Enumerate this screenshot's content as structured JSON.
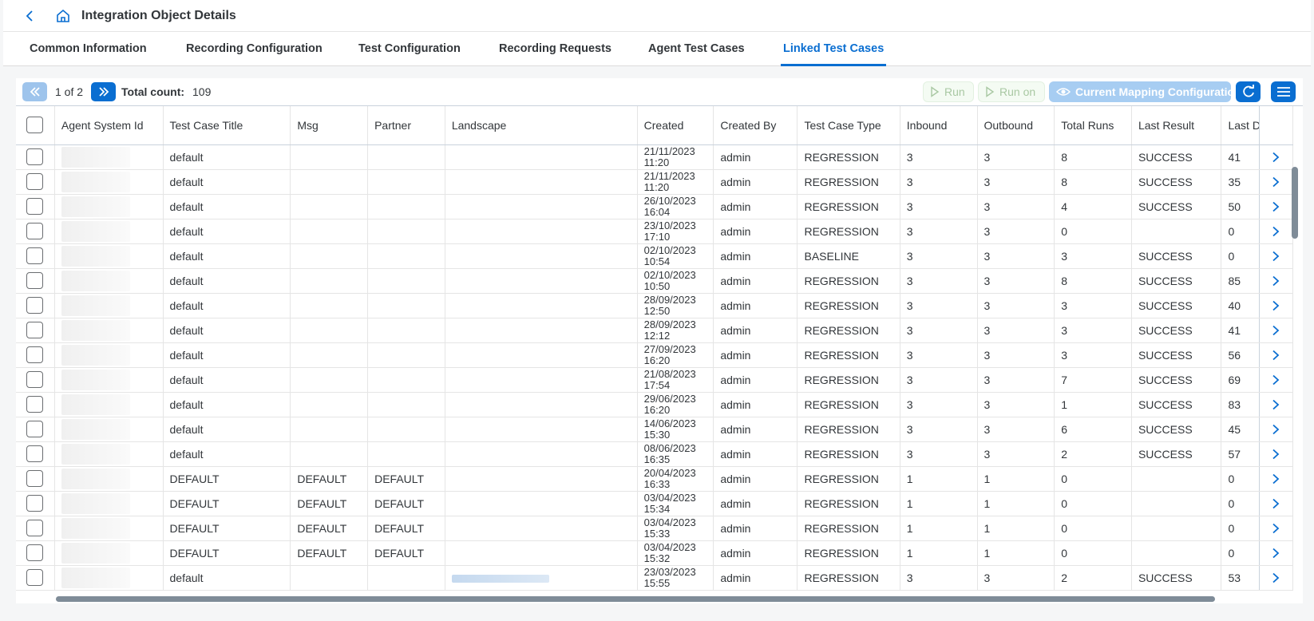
{
  "header": {
    "title": "Integration Object Details",
    "back_icon": "chevron-left-icon",
    "home_icon": "home-icon"
  },
  "tabs": [
    {
      "label": "Common Information",
      "active": false
    },
    {
      "label": "Recording Configuration",
      "active": false
    },
    {
      "label": "Test Configuration",
      "active": false
    },
    {
      "label": "Recording Requests",
      "active": false
    },
    {
      "label": "Agent Test Cases",
      "active": false
    },
    {
      "label": "Linked Test Cases",
      "active": true
    }
  ],
  "toolbar": {
    "page_indicator": "1 of 2",
    "total_count_label": "Total count:",
    "total_count_value": "109",
    "run_label": "Run",
    "run_on_label": "Run on",
    "mapping_label": "Current Mapping Configuration"
  },
  "table": {
    "columns": [
      "Agent System Id",
      "Test Case Title",
      "Msg",
      "Partner",
      "Landscape",
      "Created",
      "Created By",
      "Test Case Type",
      "Inbound",
      "Outbound",
      "Total Runs",
      "Last Result",
      "Last D"
    ],
    "rows": [
      {
        "title": "default",
        "msg": "",
        "partner": "",
        "landscape": "",
        "created": "21/11/2023 11:20",
        "created_by": "admin",
        "type": "REGRESSION",
        "inbound": "3",
        "outbound": "3",
        "total_runs": "8",
        "last_result": "SUCCESS",
        "last_d": "41"
      },
      {
        "title": "default",
        "msg": "",
        "partner": "",
        "landscape": "",
        "created": "21/11/2023 11:20",
        "created_by": "admin",
        "type": "REGRESSION",
        "inbound": "3",
        "outbound": "3",
        "total_runs": "8",
        "last_result": "SUCCESS",
        "last_d": "35"
      },
      {
        "title": "default",
        "msg": "",
        "partner": "",
        "landscape": "",
        "created": "26/10/2023 16:04",
        "created_by": "admin",
        "type": "REGRESSION",
        "inbound": "3",
        "outbound": "3",
        "total_runs": "4",
        "last_result": "SUCCESS",
        "last_d": "50"
      },
      {
        "title": "default",
        "msg": "",
        "partner": "",
        "landscape": "",
        "created": "23/10/2023 17:10",
        "created_by": "admin",
        "type": "REGRESSION",
        "inbound": "3",
        "outbound": "3",
        "total_runs": "0",
        "last_result": "",
        "last_d": "0"
      },
      {
        "title": "default",
        "msg": "",
        "partner": "",
        "landscape": "",
        "created": "02/10/2023 10:54",
        "created_by": "admin",
        "type": "BASELINE",
        "inbound": "3",
        "outbound": "3",
        "total_runs": "3",
        "last_result": "SUCCESS",
        "last_d": "0"
      },
      {
        "title": "default",
        "msg": "",
        "partner": "",
        "landscape": "",
        "created": "02/10/2023 10:50",
        "created_by": "admin",
        "type": "REGRESSION",
        "inbound": "3",
        "outbound": "3",
        "total_runs": "8",
        "last_result": "SUCCESS",
        "last_d": "85"
      },
      {
        "title": "default",
        "msg": "",
        "partner": "",
        "landscape": "",
        "created": "28/09/2023 12:50",
        "created_by": "admin",
        "type": "REGRESSION",
        "inbound": "3",
        "outbound": "3",
        "total_runs": "3",
        "last_result": "SUCCESS",
        "last_d": "40"
      },
      {
        "title": "default",
        "msg": "",
        "partner": "",
        "landscape": "",
        "created": "28/09/2023 12:12",
        "created_by": "admin",
        "type": "REGRESSION",
        "inbound": "3",
        "outbound": "3",
        "total_runs": "3",
        "last_result": "SUCCESS",
        "last_d": "41"
      },
      {
        "title": "default",
        "msg": "",
        "partner": "",
        "landscape": "",
        "created": "27/09/2023 16:20",
        "created_by": "admin",
        "type": "REGRESSION",
        "inbound": "3",
        "outbound": "3",
        "total_runs": "3",
        "last_result": "SUCCESS",
        "last_d": "56"
      },
      {
        "title": "default",
        "msg": "",
        "partner": "",
        "landscape": "",
        "created": "21/08/2023 17:54",
        "created_by": "admin",
        "type": "REGRESSION",
        "inbound": "3",
        "outbound": "3",
        "total_runs": "7",
        "last_result": "SUCCESS",
        "last_d": "69"
      },
      {
        "title": "default",
        "msg": "",
        "partner": "",
        "landscape": "",
        "created": "29/06/2023 16:20",
        "created_by": "admin",
        "type": "REGRESSION",
        "inbound": "3",
        "outbound": "3",
        "total_runs": "1",
        "last_result": "SUCCESS",
        "last_d": "83"
      },
      {
        "title": "default",
        "msg": "",
        "partner": "",
        "landscape": "",
        "created": "14/06/2023 15:30",
        "created_by": "admin",
        "type": "REGRESSION",
        "inbound": "3",
        "outbound": "3",
        "total_runs": "6",
        "last_result": "SUCCESS",
        "last_d": "45"
      },
      {
        "title": "default",
        "msg": "",
        "partner": "",
        "landscape": "",
        "created": "08/06/2023 16:35",
        "created_by": "admin",
        "type": "REGRESSION",
        "inbound": "3",
        "outbound": "3",
        "total_runs": "2",
        "last_result": "SUCCESS",
        "last_d": "57"
      },
      {
        "title": "DEFAULT",
        "msg": "DEFAULT",
        "partner": "DEFAULT",
        "landscape": "",
        "created": "20/04/2023 16:33",
        "created_by": "admin",
        "type": "REGRESSION",
        "inbound": "1",
        "outbound": "1",
        "total_runs": "0",
        "last_result": "",
        "last_d": "0"
      },
      {
        "title": "DEFAULT",
        "msg": "DEFAULT",
        "partner": "DEFAULT",
        "landscape": "",
        "created": "03/04/2023 15:34",
        "created_by": "admin",
        "type": "REGRESSION",
        "inbound": "1",
        "outbound": "1",
        "total_runs": "0",
        "last_result": "",
        "last_d": "0"
      },
      {
        "title": "DEFAULT",
        "msg": "DEFAULT",
        "partner": "DEFAULT",
        "landscape": "",
        "created": "03/04/2023 15:33",
        "created_by": "admin",
        "type": "REGRESSION",
        "inbound": "1",
        "outbound": "1",
        "total_runs": "0",
        "last_result": "",
        "last_d": "0"
      },
      {
        "title": "DEFAULT",
        "msg": "DEFAULT",
        "partner": "DEFAULT",
        "landscape": "",
        "created": "03/04/2023 15:32",
        "created_by": "admin",
        "type": "REGRESSION",
        "inbound": "1",
        "outbound": "1",
        "total_runs": "0",
        "last_result": "",
        "last_d": "0"
      },
      {
        "title": "default",
        "msg": "",
        "partner": "",
        "landscape": "redacted-link",
        "created": "23/03/2023 15:55",
        "created_by": "admin",
        "type": "REGRESSION",
        "inbound": "3",
        "outbound": "3",
        "total_runs": "2",
        "last_result": "SUCCESS",
        "last_d": "53"
      }
    ]
  },
  "colors": {
    "accent": "#0a6ed1",
    "text": "#32363a",
    "disabled_green": "#a9c8a3"
  }
}
